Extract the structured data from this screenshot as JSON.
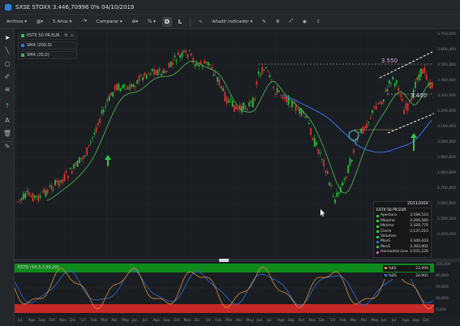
{
  "window": {
    "title": "SXSE STOXX 3.446,70996 0% 04/10/2019"
  },
  "toolbar": {
    "file": "Archivo",
    "period": "5 Años",
    "compare": "Comparar",
    "percent": "%",
    "btn_d": "D",
    "btn_l": "L",
    "add_indicator": "Añadir indicador"
  },
  "legend": [
    {
      "label": "ESTX 50 PR.EUR",
      "color": "#2ecc40"
    },
    {
      "label": "SMA (200,0)",
      "color": "#2f6fe0"
    },
    {
      "label": "SMA (35,0)",
      "color": "#4caf50"
    }
  ],
  "annotations": {
    "level_high": "3.550",
    "level_mid": "3.400"
  },
  "yaxis": {
    "ticks": [
      "3.700,000",
      "3.600,000",
      "3.500,000",
      "3.400,000",
      "3.300,000",
      "3.200,000",
      "3.100,000",
      "3.000,000",
      "2.900,000",
      "2.800,000",
      "2.700,000",
      "2.600,000",
      "2.500,000",
      "2.400,000"
    ]
  },
  "info": {
    "date": "25/11/2016",
    "title": "ESTX 50 PR.EUR",
    "rows": [
      {
        "k": "Apertura",
        "v": "3.184,510",
        "c": "#2ecc40"
      },
      {
        "k": "Máximo",
        "v": "3.206,580",
        "c": "#2ecc40"
      },
      {
        "k": "Mínimo",
        "v": "3.100,770",
        "c": "#2ecc40"
      },
      {
        "k": "Cierre",
        "v": "3.137,210",
        "c": "#2ecc40"
      },
      {
        "k": "Volumen",
        "v": "",
        "c": "#2ecc40"
      },
      {
        "k": "MovS",
        "v": "3.340,443",
        "c": "#2f6fe0"
      },
      {
        "k": "MovS",
        "v": "3.393,901",
        "c": "#4caf50"
      },
      {
        "k": "Horizontal Line",
        "v": "3.551,226",
        "c": "#c060c0"
      }
    ]
  },
  "indicator": {
    "label": "ESTO (14,3,3,50,20)",
    "k_label": "%KS",
    "k_value": "23.099",
    "d_label": "%DS",
    "d_value": "24.901",
    "ticks": [
      "100,000",
      "80,000",
      "50,000",
      "20,000",
      "0,000"
    ]
  },
  "xaxis": {
    "labels": [
      "Jul",
      "Ago",
      "Sep",
      "Oct",
      "Nov",
      "Dic",
      "'17",
      "Feb",
      "Mar",
      "Abr",
      "May",
      "Jun",
      "Jul",
      "Ago",
      "Sep",
      "Oct",
      "Nov",
      "Dic",
      "'18",
      "Feb",
      "Mar",
      "Abr",
      "May",
      "Jun",
      "Jul",
      "Ago",
      "Sep",
      "Oct",
      "Nov",
      "Dic",
      "'19",
      "Feb",
      "Mar",
      "Abr",
      "May",
      "Jun",
      "Jul",
      "Ago",
      "Sep",
      "Oct"
    ]
  }
}
